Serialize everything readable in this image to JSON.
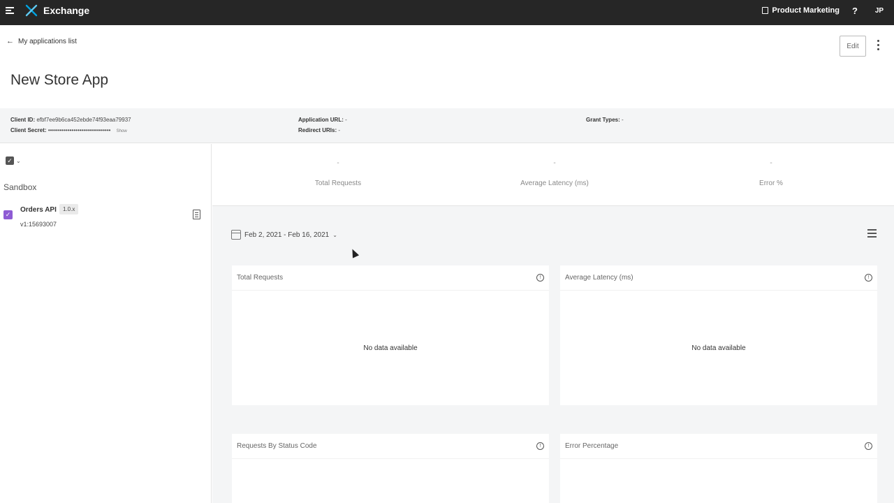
{
  "topbar": {
    "app_name": "Exchange",
    "org_name": "Product Marketing",
    "help_label": "?",
    "user_initials": "JP"
  },
  "header": {
    "back_label": "My applications list",
    "edit_label": "Edit",
    "title": "New Store App"
  },
  "credentials": {
    "client_id_label": "Client ID:",
    "client_id_value": "efbf7ee9b6ca452ebde74f93eaa79937",
    "client_secret_label": "Client Secret:",
    "client_secret_value": "••••••••••••••••••••••••••••••••",
    "show_label": "Show",
    "app_url_label": "Application URL:",
    "app_url_value": "-",
    "redirect_label": "Redirect URIs:",
    "redirect_value": "-",
    "grant_label": "Grant Types:",
    "grant_value": "-"
  },
  "sidebar": {
    "environment": "Sandbox",
    "api": {
      "name": "Orders API",
      "version": "1.0.x",
      "id": "v1:15693007"
    }
  },
  "summary": {
    "metrics": [
      {
        "value": "-",
        "label": "Total Requests"
      },
      {
        "value": "-",
        "label": "Average Latency (ms)"
      },
      {
        "value": "-",
        "label": "Error %"
      }
    ]
  },
  "dashboard": {
    "date_range": "Feb 2, 2021 - Feb 16, 2021",
    "cards": [
      {
        "title": "Total Requests",
        "empty": "No data available"
      },
      {
        "title": "Average Latency (ms)",
        "empty": "No data available"
      },
      {
        "title": "Requests By Status Code"
      },
      {
        "title": "Error Percentage"
      }
    ]
  },
  "colors": {
    "topbar": "#262626",
    "accent_logo": "#00a2df",
    "api_check": "#8e5bd4"
  }
}
